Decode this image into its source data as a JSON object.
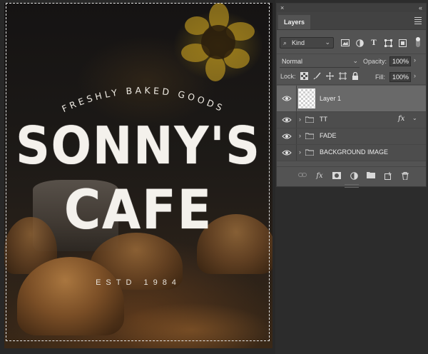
{
  "artwork": {
    "tagline": "FRESHLY BAKED GOODS",
    "title_line1": "SONNY'S",
    "title_line2": "CAFE",
    "established": "ESTD 1984"
  },
  "panel": {
    "close_glyph": "×",
    "collapse_glyph": "«",
    "tab_label": "Layers",
    "filter": {
      "kind_label": "Kind",
      "kind_icon": "search-icon",
      "icons": [
        "image-filter-icon",
        "adjustment-filter-icon",
        "type-filter-icon",
        "shape-filter-icon",
        "smart-object-filter-icon"
      ]
    },
    "blend_mode": "Normal",
    "opacity_label": "Opacity:",
    "opacity_value": "100%",
    "lock_label": "Lock:",
    "lock_icons": [
      "lock-transparent-pixels-icon",
      "lock-image-pixels-icon",
      "lock-position-icon",
      "lock-artboard-icon",
      "lock-all-icon"
    ],
    "fill_label": "Fill:",
    "fill_value": "100%",
    "layers": [
      {
        "name": "Layer 1",
        "type": "pixel",
        "selected": true
      },
      {
        "name": "TT",
        "type": "group",
        "fx": "fx"
      },
      {
        "name": "FADE",
        "type": "group"
      },
      {
        "name": "BACKGROUND IMAGE",
        "type": "group"
      }
    ],
    "footer_icons": [
      "link-layers-icon",
      "layer-style-fx-icon",
      "add-mask-icon",
      "adjustment-layer-icon",
      "new-group-icon",
      "new-layer-icon",
      "delete-layer-icon"
    ],
    "fx_glyph": "fx"
  },
  "colors": {
    "panel_bg": "#535353",
    "selected_layer": "#696969",
    "workspace": "#2c2c2c"
  }
}
